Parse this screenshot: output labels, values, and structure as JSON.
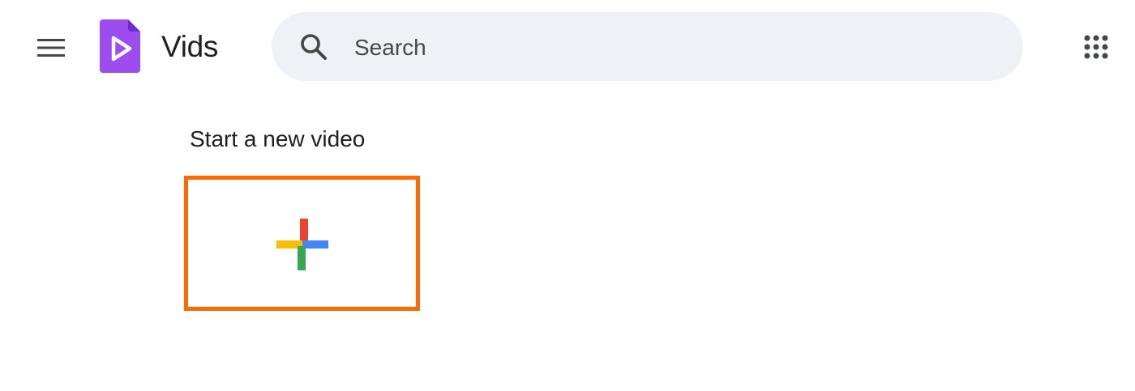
{
  "header": {
    "menu_icon": "hamburger-menu-icon",
    "logo_icon": "vids-logo-icon",
    "app_title": "Vids",
    "search": {
      "icon": "search-icon",
      "placeholder": "Search",
      "value": ""
    },
    "apps_icon": "google-apps-grid-icon"
  },
  "main": {
    "section_title": "Start a new video",
    "new_video_card": {
      "icon": "plus-icon",
      "highlight_color": "#ff6a00"
    }
  },
  "colors": {
    "brand_purple": "#9d4cf0",
    "search_bg": "#eef2f7",
    "plus_red": "#ea4335",
    "plus_blue": "#4285f4",
    "plus_yellow": "#fbbc04",
    "plus_green": "#34a853"
  }
}
